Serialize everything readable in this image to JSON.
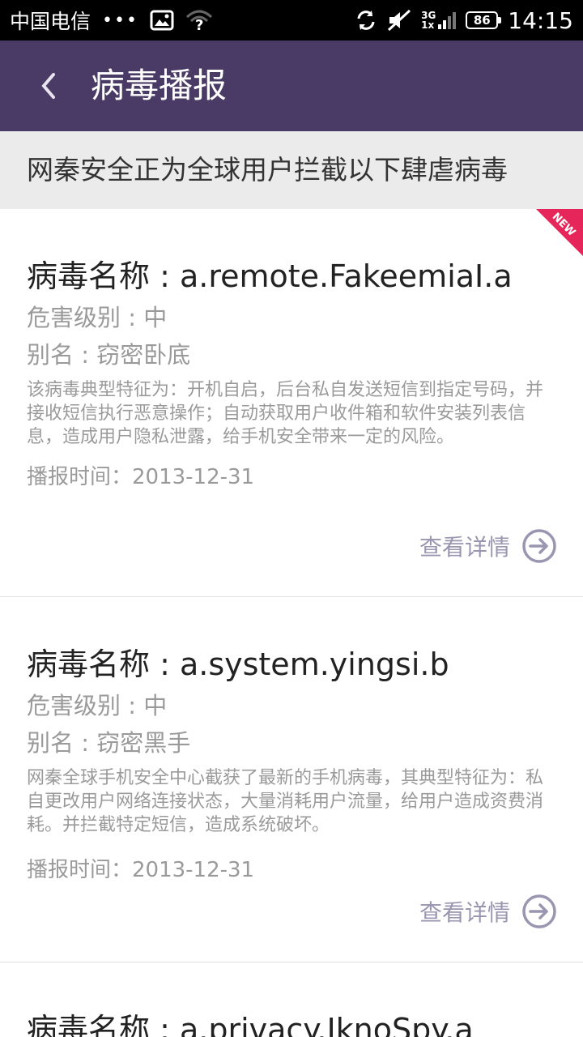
{
  "status_bar": {
    "carrier": "中国电信",
    "dots": "•••",
    "network": "3G",
    "network_sub": "1x",
    "battery": "86",
    "time": "14:15"
  },
  "header": {
    "back_icon": "chevron-left-icon",
    "title": "病毒播报"
  },
  "banner": "网秦安全正为全球用户拦截以下肆虐病毒",
  "colors": {
    "header_bg": "#4a3b66",
    "new_badge": "#e6265a",
    "detail_accent": "#9a95b0"
  },
  "viruses": [
    {
      "badge": "NEW",
      "name": "病毒名称 : a.remote.FakeemiaI.a",
      "level": "危害级别 : 中",
      "alias": "别名 : 窃密卧底",
      "description": "该病毒典型特征为：开机自启，后台私自发送短信到指定号码，并接收短信执行恶意操作；自动获取用户收件箱和软件安装列表信息，造成用户隐私泄露，给手机安全带来一定的风险。",
      "time": "播报时间：2013-12-31",
      "detail_label": "查看详情"
    },
    {
      "name": "病毒名称 : a.system.yingsi.b",
      "level": "危害级别 : 中",
      "alias": "别名 : 窃密黑手",
      "description": "网秦全球手机安全中心截获了最新的手机病毒，其典型特征为：私自更改用户网络连接状态，大量消耗用户流量，给用户造成资费消耗。并拦截特定短信，造成系统破坏。",
      "time": "播报时间：2013-12-31",
      "detail_label": "查看详情"
    },
    {
      "name": "病毒名称 : a.privacy.IknoSpy.a"
    }
  ]
}
